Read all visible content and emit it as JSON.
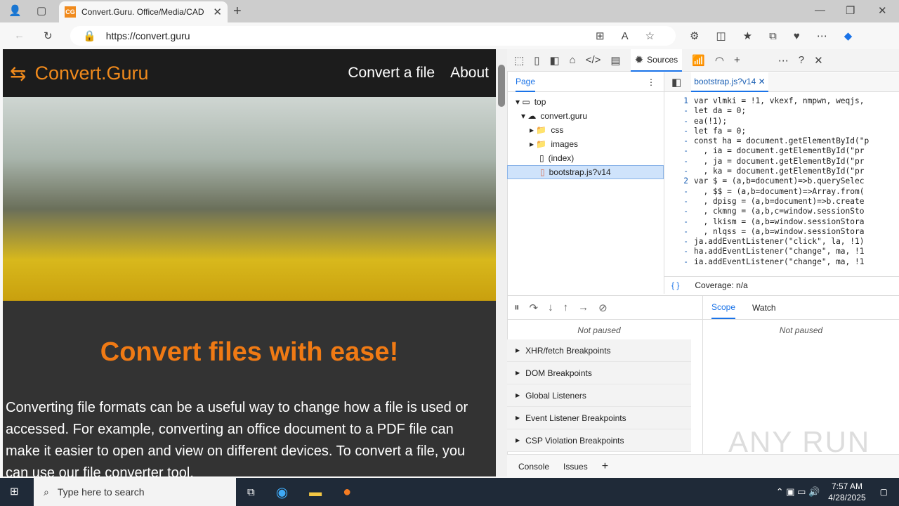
{
  "browser": {
    "tab_title": "Convert.Guru. Office/Media/CAD",
    "favicon": "CG",
    "url": "https://convert.guru"
  },
  "site": {
    "logo": "Convert.Guru",
    "nav": [
      "Convert a file",
      "About"
    ],
    "heading": "Convert files with ease!",
    "paragraph": "Converting file formats can be a useful way to change how a file is used or accessed. For example, converting an office document to a PDF file can make it easier to open and view on different devices. To convert a file, you can use our file converter tool."
  },
  "devtools": {
    "active_tab": "Sources",
    "nav_tab": "Page",
    "tree": [
      {
        "label": "top"
      },
      {
        "label": "convert.guru"
      },
      {
        "label": "css"
      },
      {
        "label": "images"
      },
      {
        "label": "(index)"
      },
      {
        "label": "bootstrap.js?v14"
      }
    ],
    "file_tab": "bootstrap.js?v14",
    "coverage": "Coverage: n/a",
    "code": [
      {
        "n": "1",
        "t": "var vlmki = !1, vkexf, nmpwn, weqjs,"
      },
      {
        "n": "-",
        "t": "let da = 0;"
      },
      {
        "n": "-",
        "t": "ea(!1);"
      },
      {
        "n": "-",
        "t": "let fa = 0;"
      },
      {
        "n": "-",
        "t": "const ha = document.getElementById(\"p"
      },
      {
        "n": "-",
        "t": "  , ia = document.getElementById(\"pr"
      },
      {
        "n": "-",
        "t": "  , ja = document.getElementById(\"pr"
      },
      {
        "n": "-",
        "t": "  , ka = document.getElementById(\"pr"
      },
      {
        "n": "2",
        "t": "var $ = (a,b=document)=>b.querySelec"
      },
      {
        "n": "-",
        "t": "  , $$ = (a,b=document)=>Array.from("
      },
      {
        "n": "-",
        "t": "  , dpisg = (a,b=document)=>b.create"
      },
      {
        "n": "-",
        "t": "  , ckmng = (a,b,c=window.sessionSto"
      },
      {
        "n": "-",
        "t": "  , lkism = (a,b=window.sessionStora"
      },
      {
        "n": "-",
        "t": "  , nlqss = (a,b=window.sessionStora"
      },
      {
        "n": "-",
        "t": "ja.addEventListener(\"click\", la, !1)"
      },
      {
        "n": "-",
        "t": "ha.addEventListener(\"change\", ma, !1"
      },
      {
        "n": "-",
        "t": "ia.addEventListener(\"change\", ma, !1"
      }
    ],
    "not_paused": "Not paused",
    "scope_tabs": [
      "Scope",
      "Watch"
    ],
    "breakpoints": [
      "XHR/fetch Breakpoints",
      "DOM Breakpoints",
      "Global Listeners",
      "Event Listener Breakpoints",
      "CSP Violation Breakpoints"
    ],
    "drawer_tabs": [
      "Console",
      "Issues"
    ]
  },
  "taskbar": {
    "search_placeholder": "Type here to search",
    "time": "7:57 AM",
    "date": "4/28/2025"
  },
  "watermark": "ANY RUN"
}
